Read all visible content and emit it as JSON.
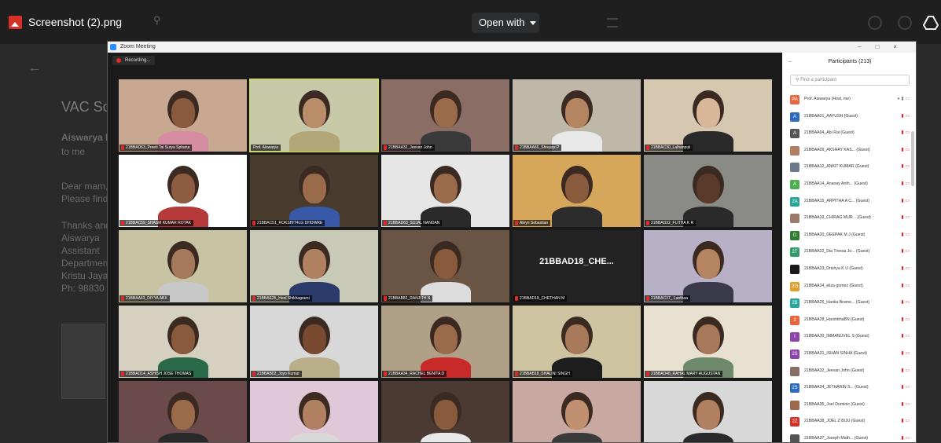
{
  "viewer": {
    "filename": "Screenshot (2).png",
    "open_with_label": "Open with"
  },
  "background_email": {
    "title_fragment": "VAC Sc",
    "sender_fragment": "Aiswarya I",
    "to_line": "to me",
    "lines": [
      "Dear mam,",
      "Please find",
      "Thanks and",
      "Aiswarya",
      "Assistant",
      "Departmen",
      "Kristu Jaya",
      "Ph: 98830"
    ]
  },
  "zoom": {
    "window_title": "Zoom Meeting",
    "recording_label": "Recording...",
    "window_controls": [
      "–",
      "□",
      "×"
    ]
  },
  "tiles": [
    {
      "label": "21BBAD63_Preeti Tai Surya Sphana",
      "bg": "#c9a892",
      "skin": "#8a5a3c",
      "shirt": "#d68ca0"
    },
    {
      "label": "Prof. Aiswarya",
      "bg": "#c8c9a9",
      "skin": "#b98c6a",
      "shirt": "#b3a77a",
      "active": true
    },
    {
      "label": "21BBAA32_Jeevan John",
      "bg": "#8a6e66",
      "skin": "#9a6a4a",
      "shirt": "#3a3a3a"
    },
    {
      "label": "21BBAA66_Shreyas P",
      "bg": "#bfb7a8",
      "skin": "#b58460",
      "shirt": "#e8e8e8"
    },
    {
      "label": "21BBAC30_Lalhanpuii",
      "bg": "#d6c8b0",
      "skin": "#d9b79a",
      "shirt": "#2a2a2a"
    },
    {
      "label": "21BBAC59_SHASM KUMAR ROTAK",
      "bg": "#ffffff",
      "skin": "#8e5c40",
      "shirt": "#b63a3a"
    },
    {
      "label": "21BBAC51_ROKSHIT4LG DHOWRE",
      "bg": "#4a3c2c",
      "skin": "#9a6a4a",
      "shirt": "#3858a8"
    },
    {
      "label": "21BBAD63_SUJAL NANDAN",
      "bg": "#e6e6e6",
      "skin": "#9a6a4a",
      "shirt": "#2a2a2a"
    },
    {
      "label": "Aleyn Sebastian",
      "bg": "#d6a65a",
      "skin": "#8a5a3c",
      "shirt": "#2c2c2c"
    },
    {
      "label": "21BBAD32_FLITHA K R",
      "bg": "#8a8a86",
      "skin": "#5a3a2a",
      "shirt": "#2a2a2a"
    },
    {
      "label": "21BBAA43_DIYYA ABX",
      "bg": "#c8c3a2",
      "skin": "#a57a5a",
      "shirt": "#c8c8c8"
    },
    {
      "label": "21BBAE25_Henl Shikhagrami",
      "bg": "#c8c9b6",
      "skin": "#b08060",
      "shirt": "#2a3a6a"
    },
    {
      "label": "21BBAB82_RANJITH N",
      "bg": "#6a5444",
      "skin": "#8a5a3c",
      "shirt": "#dcdcdc"
    },
    {
      "label": "21BBAD18_CHETHAN M",
      "big_name": "21BBAD18_CHE..."
    },
    {
      "label": "21BBAC37_ Lanthaa",
      "bg": "#b8b0c6",
      "skin": "#b58460",
      "shirt": "#3a3a4a"
    },
    {
      "label": "21BBAD14_ASHISH JOSE THOMAS",
      "bg": "#d6d0c0",
      "skin": "#8a5a3c",
      "shirt": "#2a6a4a"
    },
    {
      "label": "21BBAB02_Joyo Kumar",
      "bg": "#d8d8d8",
      "skin": "#7a4a30",
      "shirt": "#b8ae8a"
    },
    {
      "label": "21BBAA34_RACHEL BENITA D",
      "bg": "#b0a088",
      "skin": "#9a6a4a",
      "shirt": "#c82a2a"
    },
    {
      "label": "21BBAB18_SHALINI SINGH",
      "bg": "#cfc4a2",
      "skin": "#a87a5a",
      "shirt": "#1e1e1e"
    },
    {
      "label": "21BBAD48_RAHAL MARY AUGUSTAN",
      "bg": "#e8e0d0",
      "skin": "#a8785a",
      "shirt": "#6e8a6a"
    },
    {
      "label": "",
      "bg": "#6a4a4a",
      "skin": "#9a6a4a",
      "shirt": "#2a2a2a"
    },
    {
      "label": "",
      "bg": "#e0c8d8",
      "skin": "#b08060",
      "shirt": "#d8d8d8"
    },
    {
      "label": "",
      "bg": "#4a3a32",
      "skin": "#8a5a3c",
      "shirt": "#e8e8e8"
    },
    {
      "label": "",
      "bg": "#c8a8a0",
      "skin": "#c09070",
      "shirt": "#3a3a3a"
    },
    {
      "label": "",
      "bg": "#d8d8d8",
      "skin": "#b08060",
      "shirt": "#2a2a2a"
    }
  ],
  "participants": {
    "header": "Participants (213)",
    "search_placeholder": "Find a participant",
    "list": [
      {
        "name": "Prof. Aiswarya (Host, me)",
        "initials": "PA",
        "color": "#e8663d",
        "host": true
      },
      {
        "name": "21BBAA01_AAYUSH (Guest)",
        "initials": "A",
        "color": "#2d6bbf"
      },
      {
        "name": "21BBAA04_Abi Rai (Guest)",
        "initials": "A",
        "color": "#555555"
      },
      {
        "name": "21BBAA09_AKSHAY KAS... (Guest)",
        "initials": "",
        "color": "#b08060"
      },
      {
        "name": "21BBAA12_ANKIT KUMAR (Guest)",
        "initials": "",
        "color": "#6a7a8a"
      },
      {
        "name": "21BBAA14_Ananay Anth... (Guest)",
        "initials": "A",
        "color": "#4caf50"
      },
      {
        "name": "21BBAA15_ARPITHA A C... (Guest)",
        "initials": "2A",
        "color": "#26a69a"
      },
      {
        "name": "21BBAA19_CHIRAG MUR... (Guest)",
        "initials": "",
        "color": "#9a7a6a"
      },
      {
        "name": "21BBAA20_DEEPAK M J (Guest)",
        "initials": "D",
        "color": "#2e7d32"
      },
      {
        "name": "21BBAA22_Dia Treesa Jo... (Guest)",
        "initials": "2T",
        "color": "#2e9d6a"
      },
      {
        "name": "21BBAA23_Drishya K U (Guest)",
        "initials": "",
        "color": "#1a1a1a"
      },
      {
        "name": "21BBAA24_eliza gomez (Guest)",
        "initials": "2G",
        "color": "#e0a030"
      },
      {
        "name": "21BBAA26_Harika Brame... (Guest)",
        "initials": "2B",
        "color": "#26a69a"
      },
      {
        "name": "21BBAA28_HarshithaBN (Guest)",
        "initials": "2",
        "color": "#e8663d"
      },
      {
        "name": "21BBAA30_IMMANUVEL S (Guest)",
        "initials": "I",
        "color": "#8e44ad"
      },
      {
        "name": "21BBAA31_ISHAN SINHA (Guest)",
        "initials": "2S",
        "color": "#8e44ad"
      },
      {
        "name": "21BBAA32_Jeevan John (Guest)",
        "initials": "",
        "color": "#8a6e66"
      },
      {
        "name": "21BBAA34_JETHARIN S... (Guest)",
        "initials": "2S",
        "color": "#2d6bbf"
      },
      {
        "name": "21BBAA35_Joel Dominic (Guest)",
        "initials": "",
        "color": "#9a6a4a"
      },
      {
        "name": "21BBAA38_JOEL Z BIJU (Guest)",
        "initials": "2Z",
        "color": "#d93025"
      },
      {
        "name": "21BBAA37_Joseph Math... (Guest)",
        "initials": "",
        "color": "#555555"
      }
    ]
  }
}
